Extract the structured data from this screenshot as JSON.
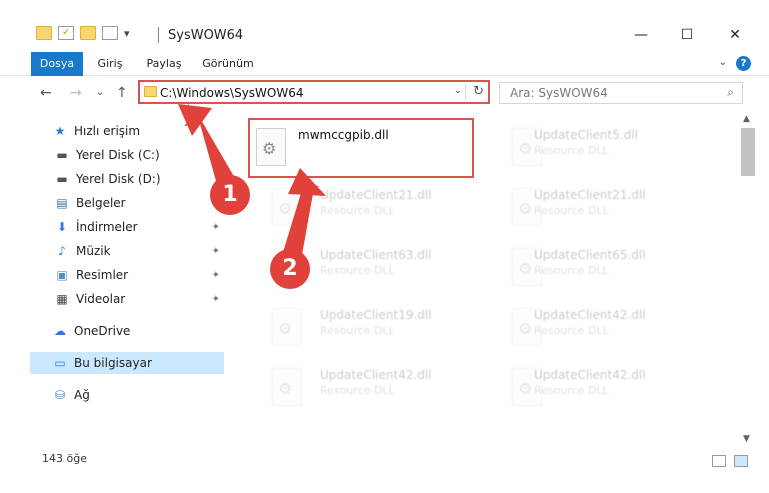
{
  "window": {
    "title": "SysWOW64",
    "controls": {
      "minimize": "—",
      "maximize": "☐",
      "close": "✕"
    }
  },
  "quick_access_toolbar": {
    "dropdown": "▾"
  },
  "ribbon": {
    "tabs": [
      "Dosya",
      "Giriş",
      "Paylaş",
      "Görünüm"
    ],
    "expand_chevron": "⌄",
    "help": "?"
  },
  "navigation": {
    "back": "←",
    "forward": "→",
    "recent": "⌄",
    "up": "↑",
    "address": "C:\\Windows\\SysWOW64",
    "address_dropdown": "⌄",
    "refresh": "↻",
    "search_placeholder": "Ara: SysWOW64",
    "search_icon": "⌕"
  },
  "sidebar": {
    "items": [
      {
        "label": "Hızlı erişim",
        "icon": "star-icon",
        "glyph": "★",
        "color": "#2b78e4",
        "pinned": false
      },
      {
        "label": "Yerel Disk (C:)",
        "icon": "drive-icon",
        "glyph": "▬",
        "color": "#555555",
        "pinned": false
      },
      {
        "label": "Yerel Disk (D:)",
        "icon": "drive-icon",
        "glyph": "▬",
        "color": "#555555",
        "pinned": false
      },
      {
        "label": "Belgeler",
        "icon": "documents-icon",
        "glyph": "▤",
        "color": "#3a6ea5",
        "pinned": true
      },
      {
        "label": "İndirmeler",
        "icon": "download-icon",
        "glyph": "⬇",
        "color": "#2b78e4",
        "pinned": true
      },
      {
        "label": "Müzik",
        "icon": "music-icon",
        "glyph": "♪",
        "color": "#2b78e4",
        "pinned": true
      },
      {
        "label": "Resimler",
        "icon": "pictures-icon",
        "glyph": "▣",
        "color": "#4f8fc9",
        "pinned": true
      },
      {
        "label": "Videolar",
        "icon": "videos-icon",
        "glyph": "▦",
        "color": "#444444",
        "pinned": true
      },
      {
        "label": "OneDrive",
        "icon": "cloud-icon",
        "glyph": "☁",
        "color": "#2b78e4",
        "pinned": false
      },
      {
        "label": "Bu bilgisayar",
        "icon": "computer-icon",
        "glyph": "▭",
        "color": "#2b78e4",
        "pinned": false
      },
      {
        "label": "Ağ",
        "icon": "network-icon",
        "glyph": "⛁",
        "color": "#2b78e4",
        "pinned": false
      }
    ],
    "pin_glyph": "📌"
  },
  "files": [
    {
      "name": "mwmccgpib.dll",
      "type": "",
      "highlighted": true
    },
    {
      "name": "UpdateClient5.dll",
      "type": "Resource DLL"
    },
    {
      "name": "UpdateClient21.dll",
      "type": "Resource DLL"
    },
    {
      "name": "UpdateClient21.dll",
      "type": "Resource DLL"
    },
    {
      "name": "UpdateClient63.dll",
      "type": "Resource DLL"
    },
    {
      "name": "UpdateClient65.dll",
      "type": "Resource DLL"
    },
    {
      "name": "UpdateClient19.dll",
      "type": "Resource DLL"
    },
    {
      "name": "UpdateClient42.dll",
      "type": "Resource DLL"
    },
    {
      "name": "UpdateClient42.dll",
      "type": "Resource DLL"
    },
    {
      "name": "UpdateClient42.dll",
      "type": "Resource DLL"
    }
  ],
  "status": {
    "item_count": "143 öğe"
  },
  "annotations": {
    "step1": "1",
    "step2": "2",
    "color": "#e0413b"
  },
  "scrollbar": {
    "up": "▲",
    "down": "▼"
  }
}
